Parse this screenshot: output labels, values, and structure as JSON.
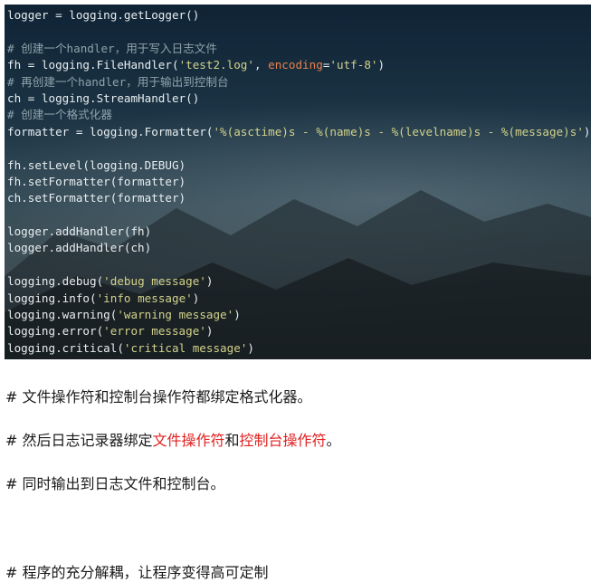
{
  "code_lines": [
    [
      {
        "t": "logger = logging.getLogger()",
        "c": ""
      }
    ],
    [],
    [
      {
        "t": "# 创建一个handler，用于写入日志文件",
        "c": "c-cmt"
      }
    ],
    [
      {
        "t": "fh = logging.FileHandler(",
        "c": ""
      },
      {
        "t": "'test2.log'",
        "c": "c-str"
      },
      {
        "t": ", ",
        "c": ""
      },
      {
        "t": "encoding",
        "c": "c-kw"
      },
      {
        "t": "=",
        "c": ""
      },
      {
        "t": "'utf-8'",
        "c": "c-str"
      },
      {
        "t": ")",
        "c": ""
      }
    ],
    [
      {
        "t": "# 再创建一个handler，用于输出到控制台",
        "c": "c-cmt"
      }
    ],
    [
      {
        "t": "ch = logging.StreamHandler()",
        "c": ""
      }
    ],
    [
      {
        "t": "# 创建一个格式化器",
        "c": "c-cmt"
      }
    ],
    [
      {
        "t": "formatter = logging.Formatter(",
        "c": ""
      },
      {
        "t": "'%(asctime)s - %(name)s - %(levelname)s - %(message)s'",
        "c": "c-str"
      },
      {
        "t": ")",
        "c": ""
      }
    ],
    [],
    [
      {
        "t": "fh.setLevel(logging.DEBUG)",
        "c": ""
      }
    ],
    [
      {
        "t": "fh.setFormatter(formatter)",
        "c": ""
      }
    ],
    [
      {
        "t": "ch.setFormatter(formatter)",
        "c": ""
      }
    ],
    [],
    [
      {
        "t": "logger.addHandler(fh)",
        "c": ""
      }
    ],
    [
      {
        "t": "logger.addHandler(ch)",
        "c": ""
      }
    ],
    [],
    [
      {
        "t": "logging.debug(",
        "c": ""
      },
      {
        "t": "'debug message'",
        "c": "c-str"
      },
      {
        "t": ")",
        "c": ""
      }
    ],
    [
      {
        "t": "logging.info(",
        "c": ""
      },
      {
        "t": "'info message'",
        "c": "c-str"
      },
      {
        "t": ")",
        "c": ""
      }
    ],
    [
      {
        "t": "logging.warning(",
        "c": ""
      },
      {
        "t": "'warning message'",
        "c": "c-str"
      },
      {
        "t": ")",
        "c": ""
      }
    ],
    [
      {
        "t": "logging.error(",
        "c": ""
      },
      {
        "t": "'error message'",
        "c": "c-str"
      },
      {
        "t": ")",
        "c": ""
      }
    ],
    [
      {
        "t": "logging.critical(",
        "c": ""
      },
      {
        "t": "'critical message'",
        "c": "c-str"
      },
      {
        "t": ")",
        "c": ""
      }
    ]
  ],
  "notes": {
    "note1": "# 文件操作符和控制台操作符都绑定格式化器。",
    "note2_prefix": "# 然后日志记录器绑定",
    "note2_red1": "文件操作符",
    "note2_mid": "和",
    "note2_red2": "控制台操作符",
    "note2_suffix": "。",
    "note3": "# 同时输出到日志文件和控制台。",
    "note4": "# 程序的充分解耦，让程序变得高可定制"
  },
  "colors": {
    "highlight_red": "#e02020",
    "string": "#d3d28a",
    "comment": "#8fa3ab",
    "keyword_arg": "#e8804a"
  }
}
